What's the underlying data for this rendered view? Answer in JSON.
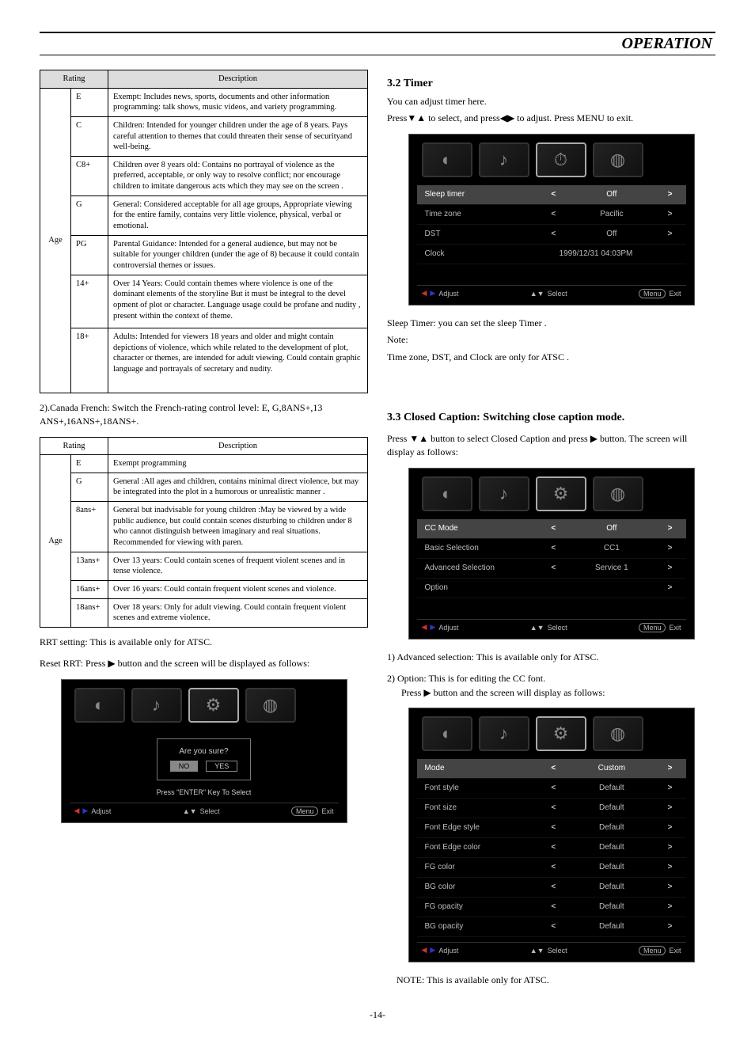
{
  "header": {
    "title": "OPERATION"
  },
  "footer_page": "-14-",
  "left": {
    "table1": {
      "head_rating": "Rating",
      "head_desc": "Description",
      "age_label": "Age",
      "rows": [
        {
          "r": "E",
          "d": "Exempt: Includes news, sports, documents and other information programming: talk shows, music videos, and variety programming."
        },
        {
          "r": "C",
          "d": "Children: Intended for younger children under the age of 8 years. Pays careful attention to themes that could threaten their sense of securityand well-being."
        },
        {
          "r": "C8+",
          "d": "Children over 8 years old: Contains no portrayal of violence as the preferred, acceptable, or only way to resolve conflict; nor encourage children to imitate dangerous acts which they may see on the screen ."
        },
        {
          "r": "G",
          "d": "General: Considered acceptable for all age groups, Appropriate viewing for the entire family, contains very little violence, physical, verbal or emotional."
        },
        {
          "r": "PG",
          "d": "Parental Guidance: Intended for a general audience, but may not be suitable for younger children (under the age of 8) because it could contain controversial themes or issues."
        },
        {
          "r": "14+",
          "d": "Over 14 Years: Could contain themes where violence is one of the dominant elements of the storyline But it must be integral to the devel opment of plot or character. Language usage could be profane and nudity , present within the context of theme."
        },
        {
          "r": "18+",
          "d": "Adults: Intended for viewers 18 years and older and might contain depictions of violence, which while related to the development of plot, character or themes, are intended for adult viewing. Could contain graphic language and portrayals of secretary and nudity."
        }
      ]
    },
    "canada_french_text": "2).Canada French: Switch the French-rating control level: E, G,8ANS+,13 ANS+,16ANS+,18ANS+.",
    "table2": {
      "head_rating": "Rating",
      "head_desc": "Description",
      "age_label": "Age",
      "rows": [
        {
          "r": "E",
          "d": "Exempt programming"
        },
        {
          "r": "G",
          "d": "General :All ages and children, contains minimal direct violence, but may be integrated into the plot in a humorous or unrealistic manner ."
        },
        {
          "r": "8ans+",
          "d": "General but inadvisable for young children :May be viewed by a wide public audience, but could contain scenes disturbing to children under 8 who cannot distinguish between imaginary and real situations. Recommended for viewing with paren."
        },
        {
          "r": "13ans+",
          "d": "Over 13 years: Could contain scenes of frequent violent scenes and in tense violence."
        },
        {
          "r": "16ans+",
          "d": "Over 16 years: Could contain frequent violent scenes and violence."
        },
        {
          "r": "18ans+",
          "d": "Over 18 years: Only for adult viewing. Could contain frequent violent scenes and extreme violence."
        }
      ]
    },
    "rrt_text": "RRT setting: This is available only for ATSC.",
    "reset_rrt_text": "Reset RRT: Press  ▶  button and the screen will be displayed as follows:",
    "confirm": {
      "msg": "Are you sure?",
      "no": "NO",
      "yes": "YES",
      "hint": "Press \"ENTER\" Key To Select"
    }
  },
  "right": {
    "sec_timer_title": "3.2 Timer",
    "timer_intro1": "You can adjust timer here.",
    "timer_intro2": "Press▼▲ to select, and press◀▶ to adjust. Press MENU to exit.",
    "timer_rows": [
      {
        "label": "Sleep timer",
        "value": "Off",
        "sel": true
      },
      {
        "label": "Time zone",
        "value": "Pacific"
      },
      {
        "label": "DST",
        "value": "Off"
      },
      {
        "label": "Clock",
        "value": "1999/12/31 04:03PM",
        "noarrow": true
      }
    ],
    "sleep_note1": "Sleep Timer:  you can set the sleep Timer .",
    "sleep_note2": "Note:",
    "sleep_note3": "Time zone, DST, and Clock are only for ATSC .",
    "sec_cc_title": "3.3 Closed  Caption: Switching close caption mode.",
    "cc_intro": "Press ▼▲ button to select  Closed  Caption and press ▶ button. The screen will  display as follows:",
    "cc_rows": [
      {
        "label": "CC Mode",
        "value": "Off",
        "sel": true
      },
      {
        "label": "Basic Selection",
        "value": "CC1"
      },
      {
        "label": "Advanced Selection",
        "value": "Service 1"
      },
      {
        "label": "Option",
        "value": " ",
        "rightonly": true
      }
    ],
    "adv_text": "1) Advanced selection: This is available only for ATSC.",
    "option_text1": "2) Option: This is for editing the CC font.",
    "option_text2": "Press  ▶  button and the screen will  display as follows:",
    "font_rows": [
      {
        "label": "Mode",
        "value": "Custom",
        "sel": true
      },
      {
        "label": "Font style",
        "value": "Default"
      },
      {
        "label": "Font size",
        "value": "Default"
      },
      {
        "label": "Font Edge style",
        "value": "Default"
      },
      {
        "label": "Font Edge color",
        "value": "Default"
      },
      {
        "label": "FG color",
        "value": "Default"
      },
      {
        "label": "BG color",
        "value": "Default"
      },
      {
        "label": "FG opacity",
        "value": "Default"
      },
      {
        "label": "BG opacity",
        "value": "Default"
      }
    ],
    "note_atsc": "NOTE: This is available only for ATSC."
  },
  "osd_footer": {
    "adjust": "Adjust",
    "select": "Select",
    "menu": "Menu",
    "exit": "Exit"
  }
}
